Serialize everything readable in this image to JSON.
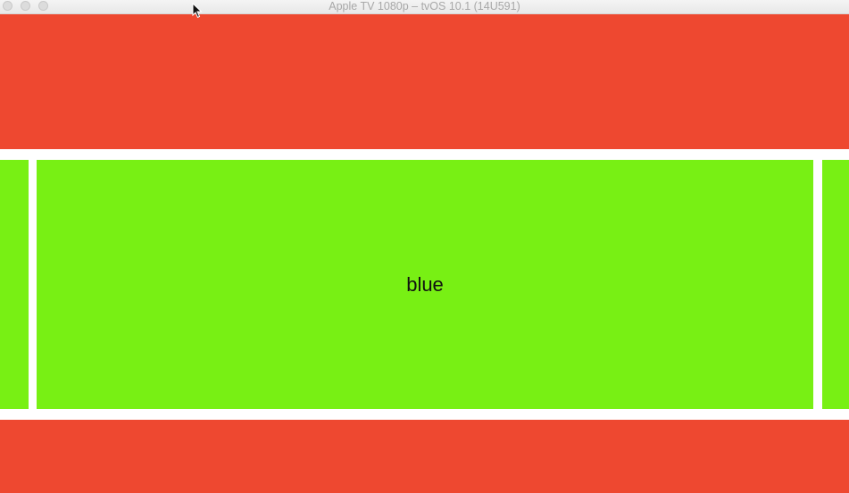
{
  "window": {
    "title": "Apple TV 1080p – tvOS 10.1 (14U591)"
  },
  "colors": {
    "red": "#ee4830",
    "green": "#78f014",
    "titlebar": "#f0f0f0"
  },
  "icons": {
    "close": "close-icon",
    "minimize": "minimize-icon",
    "zoom": "zoom-icon",
    "cursor": "mouse-pointer-icon"
  },
  "collection": {
    "focused_cell_label": "blue"
  }
}
